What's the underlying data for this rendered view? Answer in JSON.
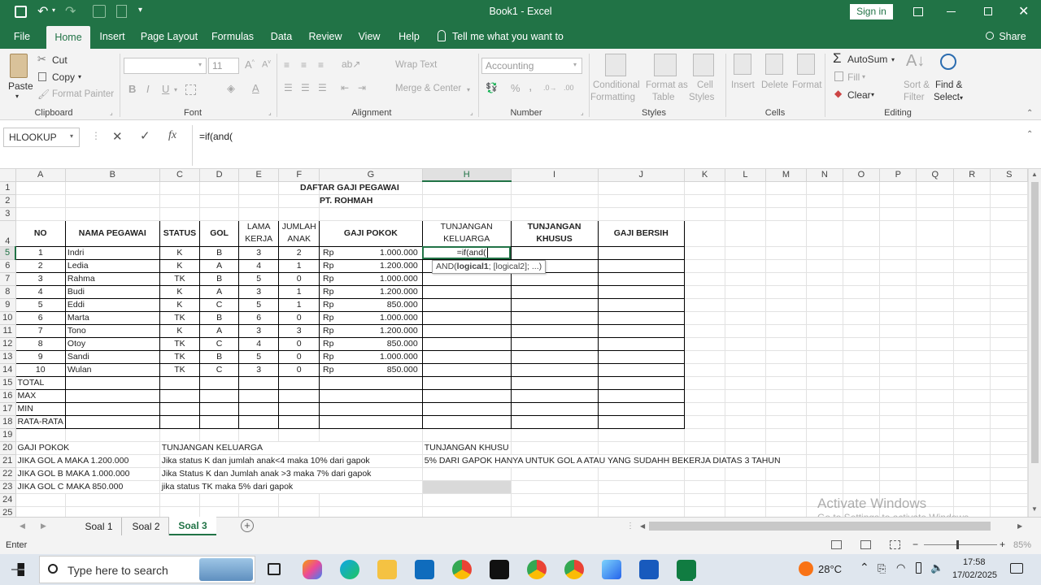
{
  "titlebar": {
    "title": "Book1 - Excel",
    "sign_in": "Sign in"
  },
  "tabs": [
    "File",
    "Home",
    "Insert",
    "Page Layout",
    "Formulas",
    "Data",
    "Review",
    "View",
    "Help"
  ],
  "tell_me": "Tell me what you want to do",
  "share": "Share",
  "ribbon": {
    "clipboard": {
      "paste": "Paste",
      "cut": "Cut",
      "copy": "Copy",
      "format_painter": "Format Painter",
      "label": "Clipboard"
    },
    "font": {
      "size": "11",
      "label": "Font"
    },
    "alignment": {
      "wrap": "Wrap Text",
      "merge": "Merge & Center",
      "label": "Alignment"
    },
    "number": {
      "format": "Accounting",
      "label": "Number"
    },
    "styles": {
      "cond": "Conditional",
      "cond2": "Formatting",
      "fmt_table": "Format as",
      "fmt_table2": "Table",
      "cell_styles": "Cell",
      "cell_styles2": "Styles",
      "label": "Styles"
    },
    "cells": {
      "insert": "Insert",
      "delete": "Delete",
      "format": "Format",
      "label": "Cells"
    },
    "editing": {
      "autosum": "AutoSum",
      "fill": "Fill",
      "clear": "Clear",
      "sort": "Sort &",
      "sort2": "Filter",
      "find": "Find &",
      "find2": "Select",
      "label": "Editing"
    }
  },
  "formula_bar": {
    "name_box": "HLOOKUP",
    "fx": "fx",
    "formula": "=if(and("
  },
  "columns": [
    "A",
    "B",
    "C",
    "D",
    "E",
    "F",
    "G",
    "H",
    "I",
    "J",
    "K",
    "L",
    "M",
    "N",
    "O",
    "P",
    "Q",
    "R",
    "S"
  ],
  "sheet": {
    "title1": "DAFTAR GAJI PEGAWAI",
    "title2": "PT. ROHMAH",
    "headers": {
      "no": "NO",
      "nama": "NAMA PEGAWAI",
      "status": "STATUS",
      "gol": "GOL",
      "lama": "LAMA KERJA",
      "jumlah": "JUMLAH ANAK",
      "gaji": "GAJI POKOK",
      "tk": "TUNJANGAN KELUARGA",
      "tkh": "TUNJANGAN KHUSUS",
      "bersih": "GAJI BERSIH"
    },
    "rows": [
      {
        "no": "1",
        "nama": "Indri",
        "status": "K",
        "gol": "B",
        "lama": "3",
        "anak": "2",
        "rp": "Rp",
        "gaji": "1.000.000"
      },
      {
        "no": "2",
        "nama": "Ledia",
        "status": "K",
        "gol": "A",
        "lama": "4",
        "anak": "1",
        "rp": "Rp",
        "gaji": "1.200.000"
      },
      {
        "no": "3",
        "nama": "Rahma",
        "status": "TK",
        "gol": "B",
        "lama": "5",
        "anak": "0",
        "rp": "Rp",
        "gaji": "1.000.000"
      },
      {
        "no": "4",
        "nama": "Budi",
        "status": "K",
        "gol": "A",
        "lama": "3",
        "anak": "1",
        "rp": "Rp",
        "gaji": "1.200.000"
      },
      {
        "no": "5",
        "nama": "Eddi",
        "status": "K",
        "gol": "C",
        "lama": "5",
        "anak": "1",
        "rp": "Rp",
        "gaji": "850.000"
      },
      {
        "no": "6",
        "nama": "Marta",
        "status": "TK",
        "gol": "B",
        "lama": "6",
        "anak": "0",
        "rp": "Rp",
        "gaji": "1.000.000"
      },
      {
        "no": "7",
        "nama": "Tono",
        "status": "K",
        "gol": "A",
        "lama": "3",
        "anak": "3",
        "rp": "Rp",
        "gaji": "1.200.000"
      },
      {
        "no": "8",
        "nama": "Otoy",
        "status": "TK",
        "gol": "C",
        "lama": "4",
        "anak": "0",
        "rp": "Rp",
        "gaji": "850.000"
      },
      {
        "no": "9",
        "nama": "Sandi",
        "status": "TK",
        "gol": "B",
        "lama": "5",
        "anak": "0",
        "rp": "Rp",
        "gaji": "1.000.000"
      },
      {
        "no": "10",
        "nama": "Wulan",
        "status": "TK",
        "gol": "C",
        "lama": "3",
        "anak": "0",
        "rp": "Rp",
        "gaji": "850.000"
      }
    ],
    "editing_cell": "=if(and(",
    "tooltip_fn": "AND(",
    "tooltip_arg1": "logical1",
    "tooltip_rest": "; [logical2]; ...)",
    "summary": [
      "TOTAL",
      "MAX",
      "MIN",
      "RATA-RATA"
    ],
    "notes": {
      "r20a": "GAJI POKOK",
      "r20c": "TUNJANGAN KELUARGA",
      "r20h": "TUNJANGAN KHUSU",
      "r21a": "JIKA GOL A MAKA 1.200.000",
      "r21c": "Jika status K dan jumlah anak<4 maka 10% dari gapok",
      "r21h": "5% DARI GAPOK HANYA UNTUK GOL A ATAU YANG SUDAHH BEKERJA DIATAS 3 TAHUN",
      "r22a": "JIKA GOL B MAKA 1.000.000",
      "r22c": "Jika Status K dan Jumlah anak >3 maka 7% dari gapok",
      "r23a": "JIKA GOL C MAKA 850.000",
      "r23c": "jika status TK maka 5% dari gapok"
    }
  },
  "sheet_tabs": [
    "Soal 1",
    "Soal 2",
    "Soal 3"
  ],
  "status": {
    "mode": "Enter",
    "zoom": "85%"
  },
  "watermark": {
    "line1": "Activate Windows",
    "line2": "Go to Settings to activate Windows."
  },
  "taskbar": {
    "search": "Type here to search",
    "temp": "28°C",
    "time": "17:58",
    "date": "17/02/2025"
  }
}
